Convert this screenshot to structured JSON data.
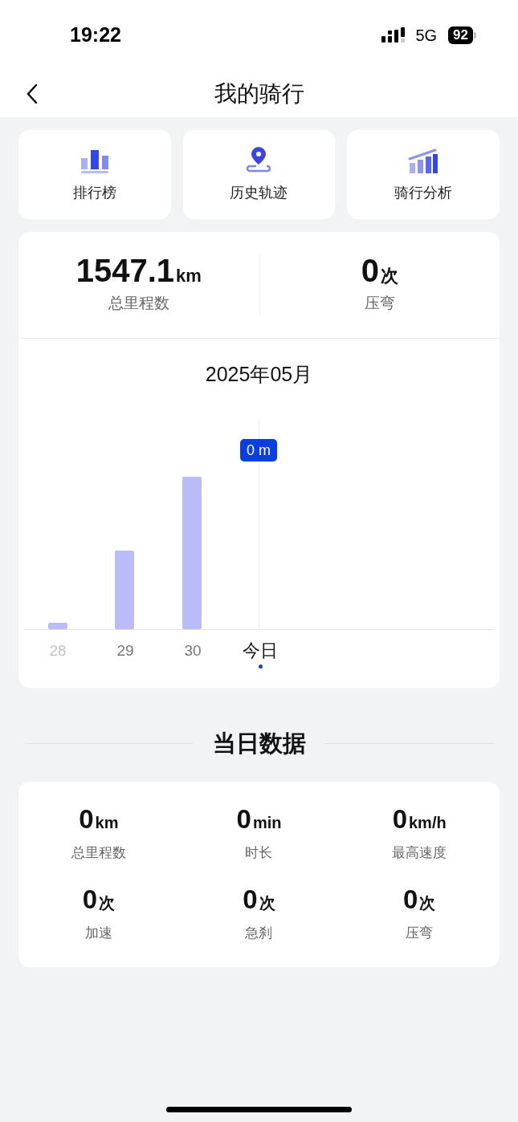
{
  "status_bar": {
    "time": "19:22",
    "network": "5G",
    "battery": "92"
  },
  "header": {
    "title": "我的骑行"
  },
  "shortcuts": [
    {
      "kind": "ranking",
      "label": "排行榜"
    },
    {
      "kind": "track",
      "label": "历史轨迹"
    },
    {
      "kind": "analysis",
      "label": "骑行分析"
    }
  ],
  "summary": {
    "stats": [
      {
        "value": "1547.1",
        "unit": "km",
        "label": "总里程数"
      },
      {
        "value": "0",
        "unit": "次",
        "label": "压弯"
      }
    ],
    "month": "2025年05月",
    "tooltip": "0 m",
    "days": [
      {
        "label": "28",
        "dimmed": true,
        "selected": false
      },
      {
        "label": "29",
        "dimmed": false,
        "selected": false
      },
      {
        "label": "30",
        "dimmed": false,
        "selected": false
      },
      {
        "label": "今日",
        "dimmed": false,
        "selected": true
      }
    ]
  },
  "daily": {
    "title": "当日数据",
    "stats": [
      {
        "value": "0",
        "unit": "km",
        "label": "总里程数"
      },
      {
        "value": "0",
        "unit": "min",
        "label": "时长"
      },
      {
        "value": "0",
        "unit": "km/h",
        "label": "最高速度"
      },
      {
        "value": "0",
        "unit": "次",
        "label": "加速"
      },
      {
        "value": "0",
        "unit": "次",
        "label": "急刹"
      },
      {
        "value": "0",
        "unit": "次",
        "label": "压弯"
      }
    ]
  }
}
